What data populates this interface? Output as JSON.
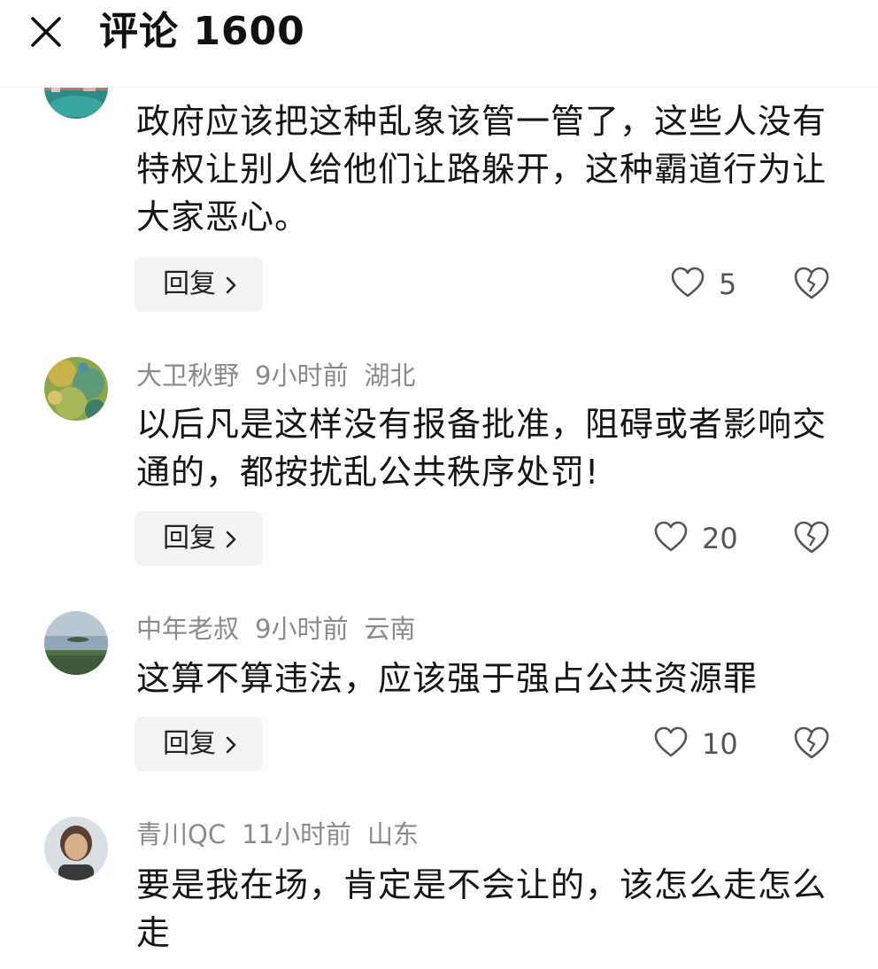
{
  "header": {
    "title": "评论 1600"
  },
  "comments": [
    {
      "author": "",
      "time": "",
      "location": "",
      "text": "政府应该把这种乱象该管一管了，这些人没有特权让别人给他们让路躲开，这种霸道行为让大家恶心。",
      "reply_label": "回复",
      "likes": "5",
      "avatar_icon": "avatar-landscape-icon"
    },
    {
      "author": "大卫秋野",
      "time": "9小时前",
      "location": "湖北",
      "text": "以后凡是这样没有报备批准，阻碍或者影响交通的，都按扰乱公共秩序处罚!",
      "reply_label": "回复",
      "likes": "20",
      "avatar_icon": "avatar-painting-icon"
    },
    {
      "author": "中年老叔",
      "time": "9小时前",
      "location": "云南",
      "text": "这算不算违法，应该强于强占公共资源罪",
      "reply_label": "回复",
      "likes": "10",
      "avatar_icon": "avatar-lake-icon"
    },
    {
      "author": "青川QC",
      "time": "11小时前",
      "location": "山东",
      "text": "要是我在场，肯定是不会让的，该怎么走怎么走",
      "reply_label": "",
      "likes": "",
      "avatar_icon": "avatar-person-icon"
    }
  ],
  "icons": {
    "close": "close-icon",
    "like": "heart-outline-icon",
    "dislike": "broken-heart-icon",
    "reply_chevron": "chevron-right-icon"
  },
  "colors": {
    "meta_text": "#8a8a8a",
    "reply_bg": "#f3f3f3",
    "body_text": "#151515"
  }
}
